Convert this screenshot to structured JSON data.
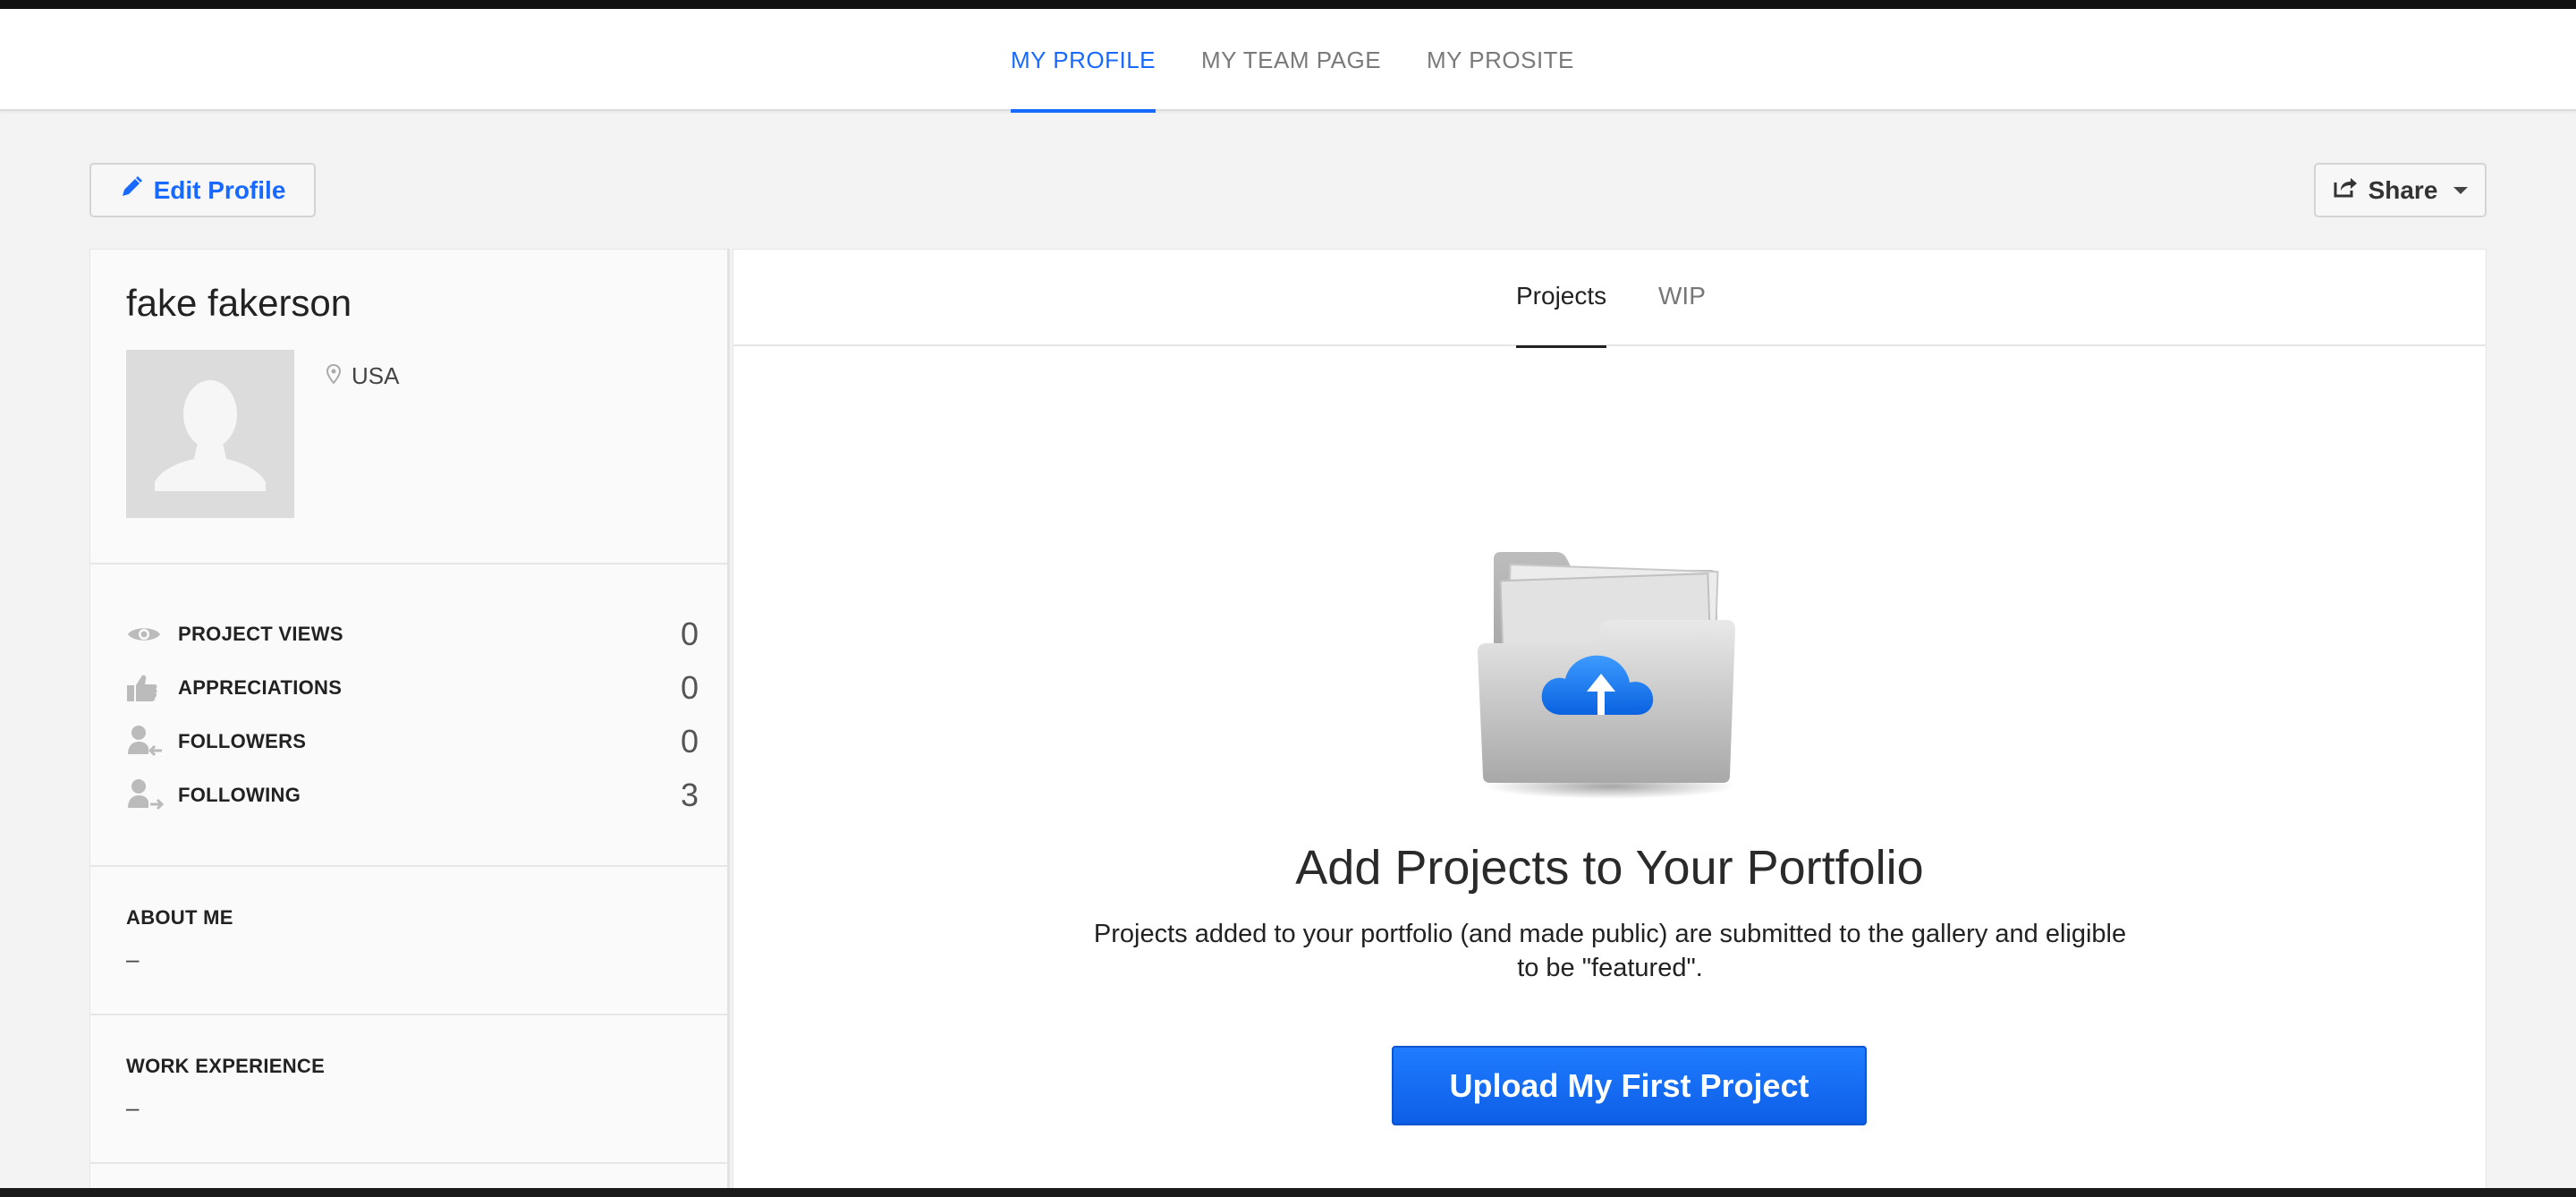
{
  "topnav": {
    "tabs": [
      {
        "label": "MY PROFILE",
        "active": true
      },
      {
        "label": "MY TEAM PAGE",
        "active": false
      },
      {
        "label": "MY PROSITE",
        "active": false
      }
    ]
  },
  "toolbar": {
    "edit_label": "Edit Profile",
    "edit_icon": "pencil-icon",
    "share_label": "Share",
    "share_icon": "share-icon"
  },
  "profile": {
    "name": "fake fakerson",
    "location": "USA",
    "stats": [
      {
        "icon": "eye-icon",
        "label": "PROJECT VIEWS",
        "value": "0"
      },
      {
        "icon": "thumbs-up-icon",
        "label": "APPRECIATIONS",
        "value": "0"
      },
      {
        "icon": "followers-icon",
        "label": "FOLLOWERS",
        "value": "0"
      },
      {
        "icon": "following-icon",
        "label": "FOLLOWING",
        "value": "3"
      }
    ],
    "about_label": "ABOUT ME",
    "about_value": "–",
    "work_label": "WORK EXPERIENCE",
    "work_value": "–"
  },
  "main": {
    "tabs": [
      {
        "label": "Projects",
        "active": true
      },
      {
        "label": "WIP",
        "active": false
      }
    ],
    "empty_title": "Add Projects to Your Portfolio",
    "empty_desc": "Projects added to your portfolio (and made public) are submitted to the gallery and eligible to be \"featured\".",
    "upload_label": "Upload My First Project"
  },
  "colors": {
    "accent": "#1769ff",
    "background": "#f3f3f3"
  }
}
